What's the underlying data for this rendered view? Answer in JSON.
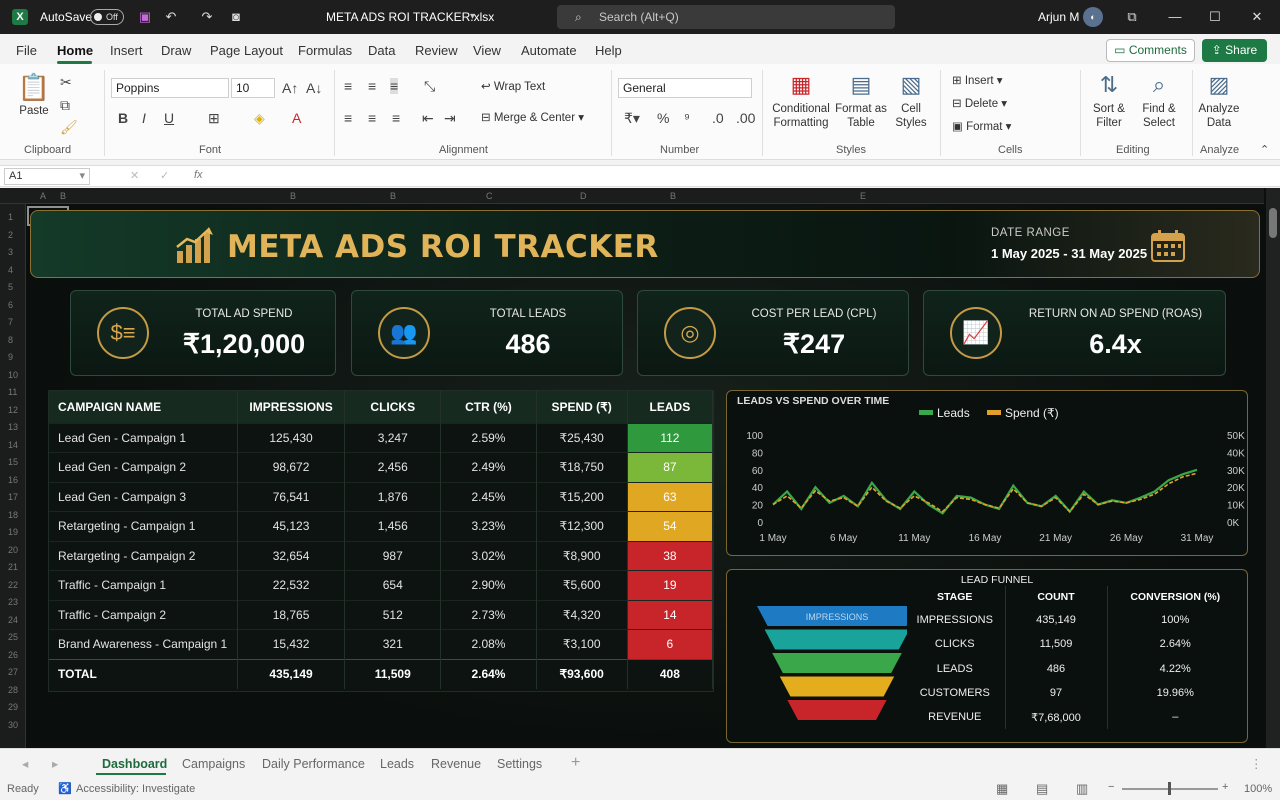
{
  "titlebar": {
    "autosave_label": "AutoSave",
    "autosave_state": "Off",
    "filename": "META ADS ROI TRACKER.xlsx",
    "search_placeholder": "Search (Alt+Q)",
    "user_name": "Arjun M"
  },
  "menu": {
    "items": [
      "File",
      "Home",
      "Insert",
      "Draw",
      "Page Layout",
      "Formulas",
      "Data",
      "Review",
      "View",
      "Automate",
      "Help"
    ],
    "active": "Home",
    "comments_label": "Comments",
    "share_label": "Share"
  },
  "ribbon": {
    "clipboard": {
      "paste": "Paste",
      "group": "Clipboard"
    },
    "font": {
      "family": "Poppins",
      "size": "10",
      "group": "Font"
    },
    "alignment": {
      "wrap_text": "Wrap Text",
      "merge_center": "Merge & Center",
      "group": "Alignment"
    },
    "number": {
      "format": "General",
      "group": "Number"
    },
    "styles": {
      "conditional": "Conditional Formatting",
      "format_table": "Format as Table",
      "cell_styles": "Cell Styles",
      "group": "Styles"
    },
    "cells": {
      "insert": "Insert",
      "delete": "Delete",
      "format": "Format",
      "group": "Cells"
    },
    "editing": {
      "sort_filter": "Sort & Filter",
      "find_select": "Find & Select",
      "group": "Editing"
    },
    "analyze": {
      "analyze_data": "Analyze Data",
      "group": "Analyze"
    }
  },
  "formula_bar": {
    "name_box": "A1",
    "fx": "fx",
    "content": ""
  },
  "column_headers": [
    "A",
    "B",
    "B",
    "B",
    "C",
    "D",
    "B",
    "E"
  ],
  "row_numbers": [
    "1",
    "2",
    "3",
    "4",
    "5",
    "6",
    "7",
    "8",
    "9",
    "10",
    "11",
    "12",
    "13",
    "14",
    "15",
    "16",
    "17",
    "18",
    "19",
    "20",
    "21",
    "22",
    "23",
    "24",
    "25",
    "26",
    "27",
    "28",
    "29",
    "30"
  ],
  "dashboard": {
    "title": "META ADS ROI TRACKER",
    "date_range_label": "DATE RANGE",
    "date_range_value": "1 May 2025 - 31 May 2025",
    "kpis": [
      {
        "label": "TOTAL AD SPEND",
        "value": "₹1,20,000",
        "icon": "money-stack-icon"
      },
      {
        "label": "TOTAL LEADS",
        "value": "486",
        "icon": "people-group-icon"
      },
      {
        "label": "COST PER LEAD (CPL)",
        "value": "₹247",
        "icon": "target-icon"
      },
      {
        "label": "RETURN ON AD SPEND (ROAS)",
        "value": "6.4x",
        "icon": "growth-chart-icon"
      }
    ],
    "campaign_table": {
      "headers": [
        "CAMPAIGN NAME",
        "IMPRESSIONS",
        "CLICKS",
        "CTR (%)",
        "SPEND (₹)",
        "LEADS"
      ],
      "rows": [
        {
          "name": "Lead Gen - Campaign 1",
          "impressions": "125,430",
          "clicks": "3,247",
          "ctr": "2.59%",
          "spend": "₹25,430",
          "leads": "112",
          "color": "#2e9a3d"
        },
        {
          "name": "Lead Gen - Campaign 2",
          "impressions": "98,672",
          "clicks": "2,456",
          "ctr": "2.49%",
          "spend": "₹18,750",
          "leads": "87",
          "color": "#7bb83a"
        },
        {
          "name": "Lead Gen - Campaign 3",
          "impressions": "76,541",
          "clicks": "1,876",
          "ctr": "2.45%",
          "spend": "₹15,200",
          "leads": "63",
          "color": "#e0a722"
        },
        {
          "name": "Retargeting - Campaign 1",
          "impressions": "45,123",
          "clicks": "1,456",
          "ctr": "3.23%",
          "spend": "₹12,300",
          "leads": "54",
          "color": "#e0a722"
        },
        {
          "name": "Retargeting - Campaign 2",
          "impressions": "32,654",
          "clicks": "987",
          "ctr": "3.02%",
          "spend": "₹8,900",
          "leads": "38",
          "color": "#c8252a"
        },
        {
          "name": "Traffic - Campaign 1",
          "impressions": "22,532",
          "clicks": "654",
          "ctr": "2.90%",
          "spend": "₹5,600",
          "leads": "19",
          "color": "#c8252a"
        },
        {
          "name": "Traffic - Campaign 2",
          "impressions": "18,765",
          "clicks": "512",
          "ctr": "2.73%",
          "spend": "₹4,320",
          "leads": "14",
          "color": "#c8252a"
        },
        {
          "name": "Brand Awareness - Campaign 1",
          "impressions": "15,432",
          "clicks": "321",
          "ctr": "2.08%",
          "spend": "₹3,100",
          "leads": "6",
          "color": "#c8252a"
        }
      ],
      "total": {
        "name": "TOTAL",
        "impressions": "435,149",
        "clicks": "11,509",
        "ctr": "2.64%",
        "spend": "₹93,600",
        "leads": "408"
      }
    },
    "line_chart": {
      "title": "LEADS VS SPEND OVER TIME",
      "legend": [
        {
          "name": "Leads",
          "color": "#3aa84a"
        },
        {
          "name": "Spend (₹)",
          "color": "#e0a02a"
        }
      ],
      "left_ticks": [
        "100",
        "80",
        "60",
        "40",
        "20",
        "0"
      ],
      "right_ticks": [
        "50K",
        "40K",
        "30K",
        "20K",
        "10K",
        "0K"
      ],
      "x_ticks": [
        "1 May",
        "6 May",
        "11 May",
        "16 May",
        "21 May",
        "26 May",
        "31 May"
      ]
    },
    "funnel": {
      "title": "LEAD FUNNEL",
      "funnel_label": "IMPRESSIONS",
      "headers": [
        "STAGE",
        "COUNT",
        "CONVERSION (%)"
      ],
      "rows": [
        {
          "stage": "IMPRESSIONS",
          "count": "435,149",
          "conv": "100%",
          "color": "#1f7ac4"
        },
        {
          "stage": "CLICKS",
          "count": "11,509",
          "conv": "2.64%",
          "color": "#1aa39a"
        },
        {
          "stage": "LEADS",
          "count": "486",
          "conv": "4.22%",
          "color": "#3aa84a"
        },
        {
          "stage": "CUSTOMERS",
          "count": "97",
          "conv": "19.96%",
          "color": "#e3ad1e"
        },
        {
          "stage": "REVENUE",
          "count": "₹7,68,000",
          "conv": "–",
          "color": "#c8252a"
        }
      ]
    }
  },
  "chart_data": {
    "type": "line",
    "title": "LEADS VS SPEND OVER TIME",
    "x": [
      "1 May",
      "2 May",
      "3 May",
      "4 May",
      "5 May",
      "6 May",
      "7 May",
      "8 May",
      "9 May",
      "10 May",
      "11 May",
      "12 May",
      "13 May",
      "14 May",
      "15 May",
      "16 May",
      "17 May",
      "18 May",
      "19 May",
      "20 May",
      "21 May",
      "22 May",
      "23 May",
      "24 May",
      "25 May",
      "26 May",
      "27 May",
      "28 May",
      "29 May",
      "30 May",
      "31 May"
    ],
    "series": [
      {
        "name": "Leads",
        "axis": "left",
        "values": [
          20,
          35,
          15,
          40,
          22,
          30,
          18,
          45,
          25,
          15,
          35,
          20,
          10,
          30,
          28,
          20,
          15,
          42,
          22,
          18,
          30,
          12,
          35,
          20,
          25,
          22,
          28,
          35,
          48,
          55,
          60
        ]
      },
      {
        "name": "Spend (₹)",
        "axis": "right",
        "values": [
          10000,
          15000,
          8000,
          18000,
          12000,
          14000,
          9000,
          20000,
          12000,
          8000,
          15000,
          11000,
          6000,
          14000,
          13000,
          10000,
          8000,
          19000,
          11000,
          9000,
          14000,
          6000,
          16000,
          10000,
          12000,
          11000,
          13000,
          16000,
          22000,
          26000,
          28000
        ]
      }
    ],
    "ylim_left": [
      0,
      100
    ],
    "ylim_right": [
      0,
      50000
    ],
    "legend_position": "top-center"
  },
  "sheet_tabs": {
    "tabs": [
      "Dashboard",
      "Campaigns",
      "Daily Performance",
      "Leads",
      "Revenue",
      "Settings"
    ],
    "active": "Dashboard"
  },
  "status": {
    "ready": "Ready",
    "accessibility": "Accessibility: Investigate",
    "zoom": "100%"
  }
}
